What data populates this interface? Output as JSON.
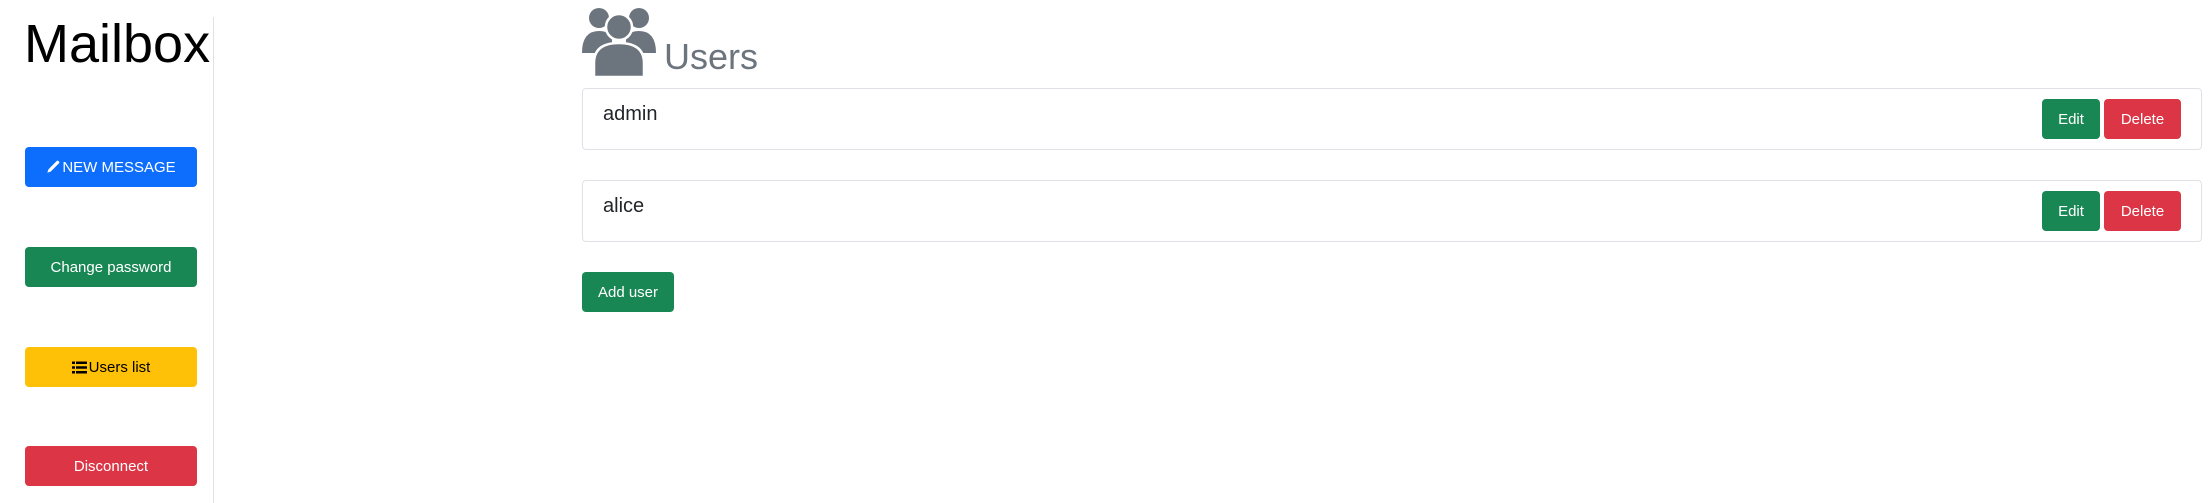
{
  "sidebar": {
    "brand": "Mailbox",
    "buttons": {
      "new_message": {
        "label": "NEW MESSAGE",
        "icon": "pencil-icon",
        "color": "#0d6efd"
      },
      "change_password": {
        "label": "Change password",
        "color": "#198754"
      },
      "users_list": {
        "label": "Users list",
        "icon": "list-icon",
        "color": "#ffc107"
      },
      "disconnect": {
        "label": "Disconnect",
        "color": "#dc3545"
      }
    }
  },
  "main": {
    "title": "Users",
    "title_icon": "users-icon",
    "users": [
      {
        "name": "admin",
        "edit_label": "Edit",
        "delete_label": "Delete"
      },
      {
        "name": "alice",
        "edit_label": "Edit",
        "delete_label": "Delete"
      }
    ],
    "add_user_label": "Add user"
  },
  "colors": {
    "success": "#198754",
    "danger": "#dc3545",
    "primary": "#0d6efd",
    "warning": "#ffc107",
    "muted": "#6c757d"
  }
}
